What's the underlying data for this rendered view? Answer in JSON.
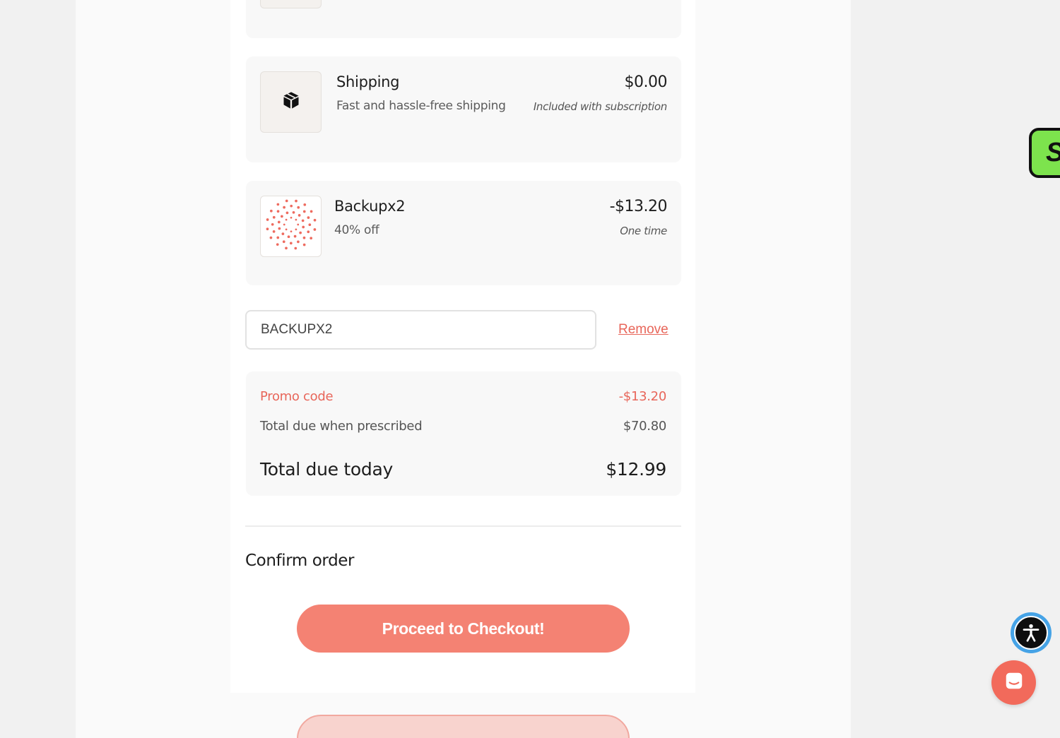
{
  "line_items": [
    {
      "title": "Shipping",
      "subtitle": "Fast and hassle-free shipping",
      "price": "$0.00",
      "note": "Included with subscription",
      "icon": "package-icon"
    },
    {
      "title": "Backupx2",
      "subtitle": "40% off",
      "price": "-$13.20",
      "note": "One time",
      "icon": "dotted-sunburst-logo"
    }
  ],
  "promo": {
    "value": "BACKUPX2",
    "remove_label": "Remove"
  },
  "summary": {
    "promo_label": "Promo code",
    "promo_value": "-$13.20",
    "prescribed_label": "Total due when prescribed",
    "prescribed_value": "$70.80",
    "today_label": "Total due today",
    "today_value": "$12.99"
  },
  "confirm": {
    "title": "Confirm order",
    "checkout_label": "Proceed to Checkout!"
  },
  "side_tab_label": "S",
  "colors": {
    "accent": "#f48273",
    "promo_red": "#e8665a",
    "side_tab_green": "#7de34d",
    "a11y_blue": "#46a3e6",
    "chat_red": "#f26a5b"
  }
}
